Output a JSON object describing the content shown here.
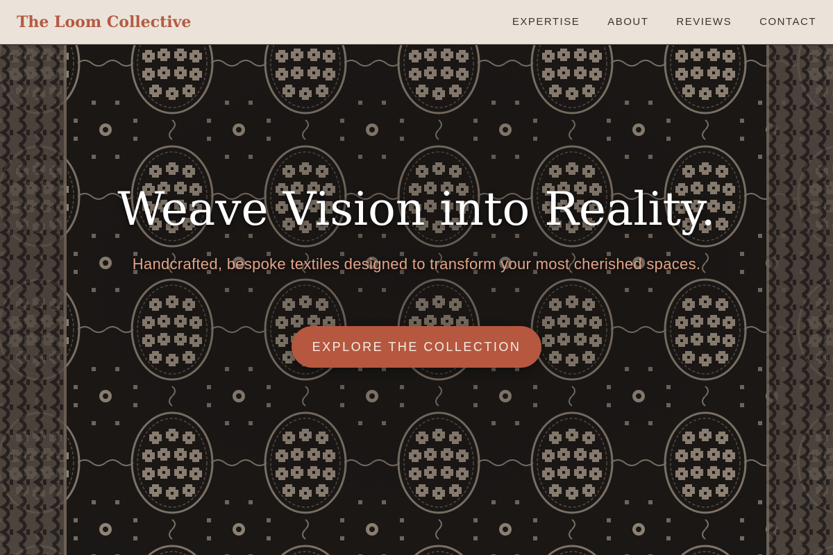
{
  "header": {
    "brand": "The Loom Collective",
    "nav": [
      {
        "label": "EXPERTISE"
      },
      {
        "label": "ABOUT"
      },
      {
        "label": "REVIEWS"
      },
      {
        "label": "CONTACT"
      }
    ]
  },
  "hero": {
    "headline": "Weave Vision into Reality.",
    "tagline": "Handcrafted, bespoke textiles designed to transform your most cherished spaces.",
    "cta_label": "EXPLORE THE COLLECTION",
    "background": "woven-textile-pattern"
  },
  "colors": {
    "accent": "#b5583f",
    "brand": "#b55a42",
    "header_bg": "#ebe3da",
    "tagline": "#e2a487",
    "pattern_dark": "#1b1816",
    "pattern_light": "#9c8f80"
  }
}
